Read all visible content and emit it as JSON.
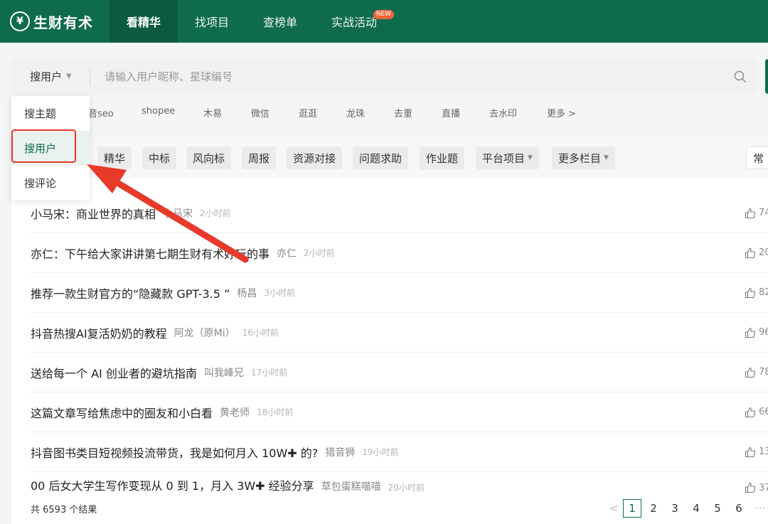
{
  "header": {
    "logo_mark": "㊍",
    "logo_text": "生财有术",
    "nav": [
      {
        "label": "看精华"
      },
      {
        "label": "找项目"
      },
      {
        "label": "查榜单"
      },
      {
        "label": "实战活动",
        "badge": "NEW"
      }
    ]
  },
  "search": {
    "type_selected": "搜用户",
    "placeholder": "请输入用户昵称、星球编号",
    "value": ""
  },
  "dropdown": {
    "items": [
      "搜主题",
      "搜用户",
      "搜评论"
    ],
    "selected": "搜用户"
  },
  "hot_tags": [
    "音seo",
    "shopee",
    "木易",
    "微信",
    "逛逛",
    "龙珠",
    "去重",
    "直播",
    "去水印",
    "更多 >"
  ],
  "filters": [
    "精华",
    "中标",
    "风向标",
    "周报",
    "资源对接",
    "问题求助",
    "作业题",
    "平台项目",
    "更多栏目",
    "常"
  ],
  "rows": [
    {
      "title": "小马宋：商业世界的真相",
      "author": "小马宋",
      "time": "2小时前",
      "likes": "74"
    },
    {
      "title": "亦仁：下午给大家讲讲第七期生财有术好玩的事",
      "author": "亦仁",
      "time": "2小时前",
      "likes": "20"
    },
    {
      "title": "推荐一款生财官方的“隐藏款 GPT-3.5 ”",
      "author": "杨昌",
      "time": "3小时前",
      "likes": "82"
    },
    {
      "title": "抖音热搜AI复活奶奶的教程",
      "author": "阿龙（原Mi）",
      "time": "16小时前",
      "likes": "96"
    },
    {
      "title": "送给每一个 AI 创业者的避坑指南",
      "author": "叫我峰兄",
      "time": "17小时前",
      "likes": "78"
    },
    {
      "title": "这篇文章写给焦虑中的圈友和小白看",
      "author": "黄老师",
      "time": "18小时前",
      "likes": "66"
    },
    {
      "title": "抖音图书类目短视频投流带货，我是如何月入 10W✚ 的?",
      "author": "猎音狮",
      "time": "19小时前",
      "likes": "13"
    },
    {
      "title": "00 后女大学生写作变现从 0 到 1，月入 3W✚ 经验分享",
      "author": "草包蛋糕喵喵",
      "time": "20小时前",
      "likes": "37"
    }
  ],
  "footer": {
    "total": "共 6593 个结果",
    "prev": "<",
    "pages": [
      "1",
      "2",
      "3",
      "4",
      "5",
      "6"
    ],
    "current": "1",
    "ellipsis": "···"
  },
  "colors": {
    "brand": "#0f6b4e",
    "annotation": "#e8392a"
  }
}
